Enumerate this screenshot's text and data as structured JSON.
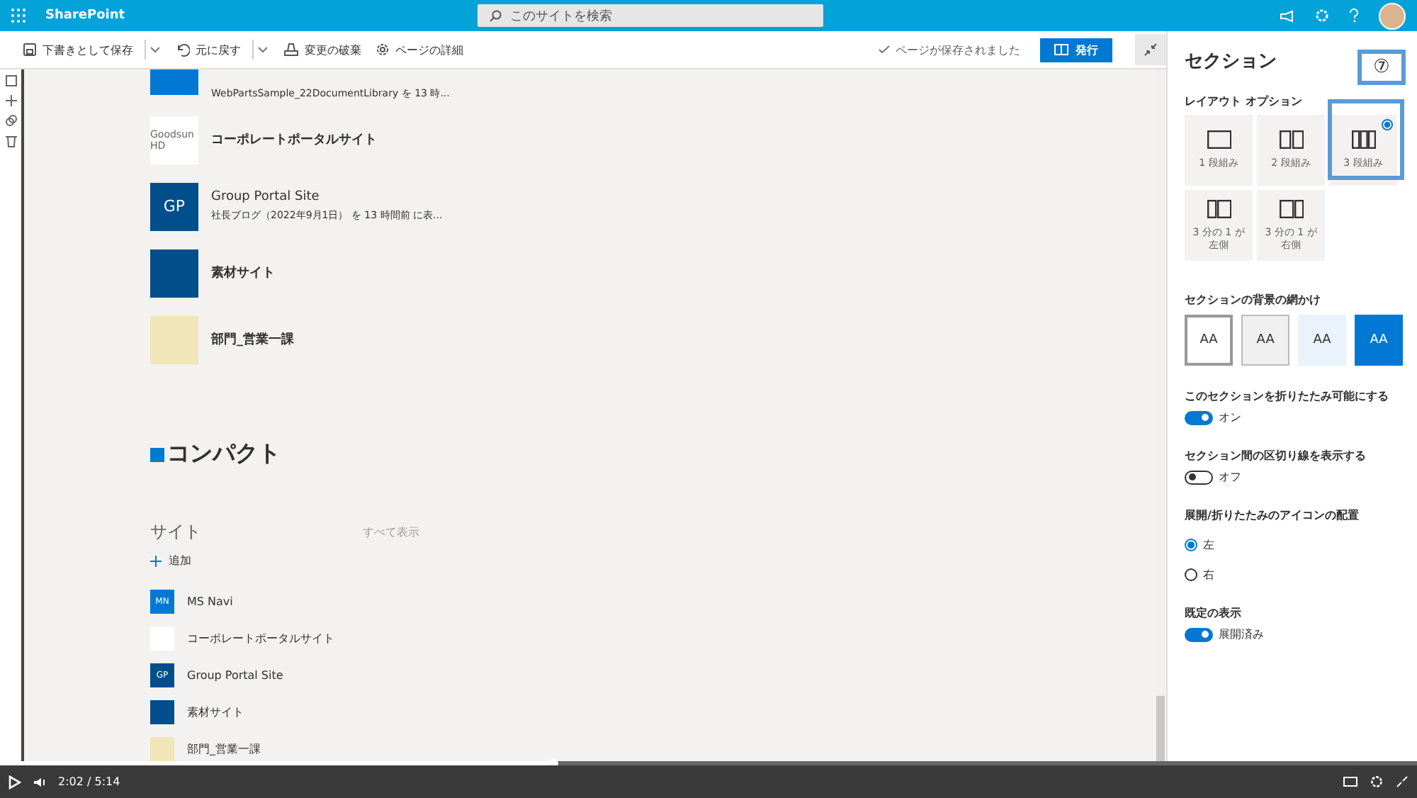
{
  "top_bar": {
    "app_name": "SharePoint",
    "search": {
      "placeholder": "このサイトを検索"
    }
  },
  "toolbar": {
    "actions": [
      {
        "kind": "save",
        "label": "下書きとして保存",
        "menu": true
      },
      {
        "kind": "undo",
        "label": "元に戻す",
        "menu": true
      },
      {
        "kind": "discard",
        "label": "変更の破棄",
        "menu": false
      },
      {
        "kind": "details",
        "label": "ページの詳細",
        "menu": false
      }
    ],
    "status": "ページが保存されました",
    "publish": "発行"
  },
  "sites_web_part": {
    "items": [
      {
        "logo": {
          "kind": "initials",
          "color": "#0078d4"
        },
        "subtitle": "WebPartsSample_22DocumentLibrary を 13 時..."
      },
      {
        "logo": {
          "kind": "wordmark",
          "text": "Goodsun HD",
          "color": "#ffffff"
        },
        "title": "コーポレートポータルサイト"
      },
      {
        "logo": {
          "kind": "initials",
          "text": "GP",
          "color": "#004e8c"
        },
        "title": "Group Portal Site",
        "subtitle": "社長ブログ（2022年9月1日） を 13 時間前 に表..."
      },
      {
        "logo": {
          "kind": "solid",
          "color": "#004e8c"
        },
        "title": "素材サイト"
      },
      {
        "logo": {
          "kind": "picture",
          "color": "#f1e6b8"
        },
        "title": "部門_営業一課"
      }
    ]
  },
  "compact_heading": "コンパクト",
  "compact_web_part": {
    "title": "サイト",
    "see_all": "すべて表示",
    "add": "追加",
    "items": [
      {
        "logo": {
          "kind": "initials",
          "text": "MN",
          "color": "#0078d4"
        },
        "title": "MS Navi"
      },
      {
        "logo": {
          "kind": "wordmark",
          "color": "#ffffff"
        },
        "title": "コーポレートポータルサイト"
      },
      {
        "logo": {
          "kind": "initials",
          "text": "GP",
          "color": "#004e8c"
        },
        "title": "Group Portal Site"
      },
      {
        "logo": {
          "kind": "solid",
          "color": "#004e8c"
        },
        "title": "素材サイト"
      },
      {
        "logo": {
          "kind": "picture",
          "color": "#f1e6b8"
        },
        "title": "部門_営業一課"
      }
    ]
  },
  "panel": {
    "title": "セクション",
    "layout_label": "レイアウト オプション",
    "layouts": [
      {
        "kind": "one",
        "label": "1 段組み",
        "selected": false
      },
      {
        "kind": "two",
        "label": "2 段組み",
        "selected": false
      },
      {
        "kind": "three",
        "label": "3 段組み",
        "selected": true
      },
      {
        "kind": "left_third",
        "label": "3 分の 1 が左側",
        "selected": false
      },
      {
        "kind": "right_third",
        "label": "3 分の 1 が右側",
        "selected": false
      }
    ],
    "background_label": "セクションの背景の網かけ",
    "backgrounds": [
      {
        "kind": "none",
        "glyph": "AA",
        "selected": true
      },
      {
        "kind": "neutral",
        "glyph": "AA",
        "selected": false
      },
      {
        "kind": "soft",
        "glyph": "AA",
        "selected": false
      },
      {
        "kind": "strong",
        "glyph": "AA",
        "selected": false
      }
    ],
    "settings": [
      {
        "kind": "toggle",
        "label": "このセクションを折りたたみ可能にする",
        "on": true,
        "state_text": "オン"
      },
      {
        "kind": "toggle",
        "label": "セクション間の区切り線を表示する",
        "on": false,
        "state_text": "オフ"
      },
      {
        "kind": "radio",
        "label": "展開/折りたたみのアイコンの配置",
        "options": [
          {
            "label": "左",
            "selected": true
          },
          {
            "label": "右",
            "selected": false
          }
        ]
      },
      {
        "kind": "toggle",
        "label": "既定の表示",
        "on": true,
        "state_text": "展開済み"
      }
    ]
  },
  "annotation": {
    "label": "⑦"
  },
  "video": {
    "time": "2:02 / 5:14",
    "level": 0.39
  }
}
